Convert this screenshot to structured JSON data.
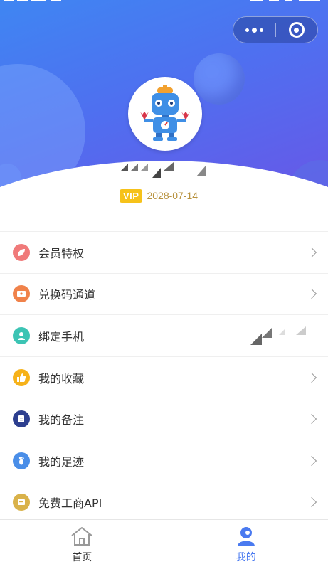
{
  "header": {
    "vip_badge": "VIP",
    "vip_expiry": "2028-07-14"
  },
  "menu": {
    "items": [
      {
        "label": "会员特权",
        "icon": "leaf-icon",
        "color": "#f07a7a"
      },
      {
        "label": "兑换码通道",
        "icon": "ticket-icon",
        "color": "#f0824a"
      },
      {
        "label": "绑定手机",
        "icon": "user-icon",
        "color": "#3cc4b4"
      },
      {
        "label": "我的收藏",
        "icon": "thumbs-up-icon",
        "color": "#f6b21a"
      },
      {
        "label": "我的备注",
        "icon": "note-icon",
        "color": "#2d3f8f"
      },
      {
        "label": "我的足迹",
        "icon": "footprint-icon",
        "color": "#4a8ee8"
      },
      {
        "label": "免费工商API",
        "icon": "api-icon",
        "color": "#d9b24a"
      }
    ]
  },
  "tabbar": {
    "home": "首页",
    "mine": "我的"
  },
  "colors": {
    "accent": "#4a7af0",
    "vip": "#f6c21a"
  }
}
